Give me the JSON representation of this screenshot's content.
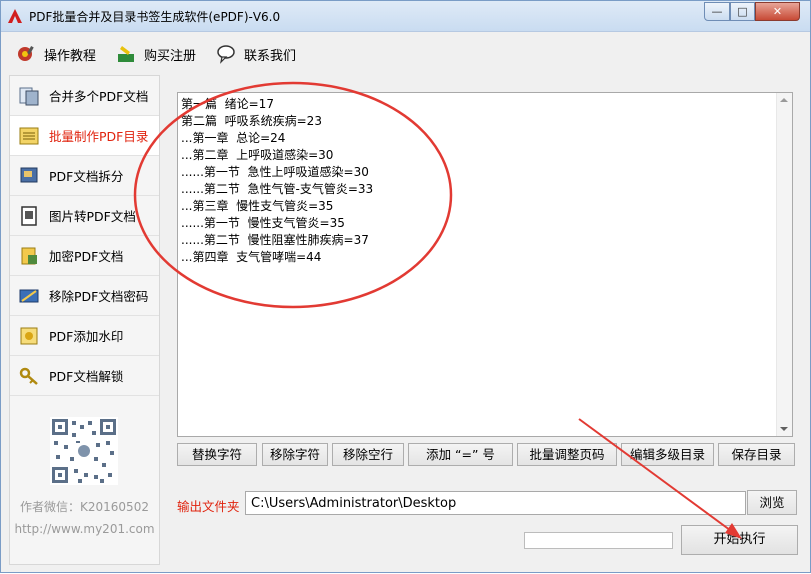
{
  "window": {
    "title": "PDF批量合并及目录书签生成软件(ePDF)-V6.0",
    "controls": {
      "minimize": "—",
      "maximize": "□",
      "close": "✕"
    }
  },
  "toolbar": {
    "items": [
      {
        "label": "操作教程",
        "icon": "tutorial-icon"
      },
      {
        "label": "购买注册",
        "icon": "register-icon"
      },
      {
        "label": "联系我们",
        "icon": "contact-icon"
      }
    ]
  },
  "sidebar": {
    "items": [
      {
        "label": "合并多个PDF文档",
        "icon": "merge-icon",
        "active": false
      },
      {
        "label": "批量制作PDF目录",
        "icon": "toc-icon",
        "active": true
      },
      {
        "label": "PDF文档拆分",
        "icon": "split-icon",
        "active": false
      },
      {
        "label": "图片转PDF文档",
        "icon": "image-to-pdf-icon",
        "active": false
      },
      {
        "label": "加密PDF文档",
        "icon": "encrypt-icon",
        "active": false
      },
      {
        "label": "移除PDF文档密码",
        "icon": "remove-password-icon",
        "active": false
      },
      {
        "label": "PDF添加水印",
        "icon": "watermark-icon",
        "active": false
      },
      {
        "label": "PDF文档解锁",
        "icon": "unlock-icon",
        "active": false
      }
    ],
    "author": "作者微信：K20160502",
    "website": "http://www.my201.com"
  },
  "editor": {
    "lines": [
      "第一篇  绪论=17",
      "第二篇  呼吸系统疾病=23",
      "...第一章  总论=24",
      "...第二章  上呼吸道感染=30",
      "......第一节  急性上呼吸道感染=30",
      "......第二节  急性气管-支气管炎=33",
      "...第三章  慢性支气管炎=35",
      "......第一节  慢性支气管炎=35",
      "......第二节  慢性阻塞性肺疾病=37",
      "...第四章  支气管哮喘=44"
    ]
  },
  "actions": {
    "buttons": [
      "替换字符",
      "移除字符",
      "移除空行",
      "添加 “=” 号",
      "批量调整页码",
      "编辑多级目录",
      "保存目录"
    ]
  },
  "output": {
    "label": "输出文件夹",
    "path": "C:\\Users\\Administrator\\Desktop",
    "browse": "浏览"
  },
  "progress": {
    "value": 0
  },
  "start_button": "开始执行",
  "colors": {
    "accent_red": "#e0230e",
    "annotation_red": "#e23a33",
    "title_bar": "#cfe0f3"
  }
}
